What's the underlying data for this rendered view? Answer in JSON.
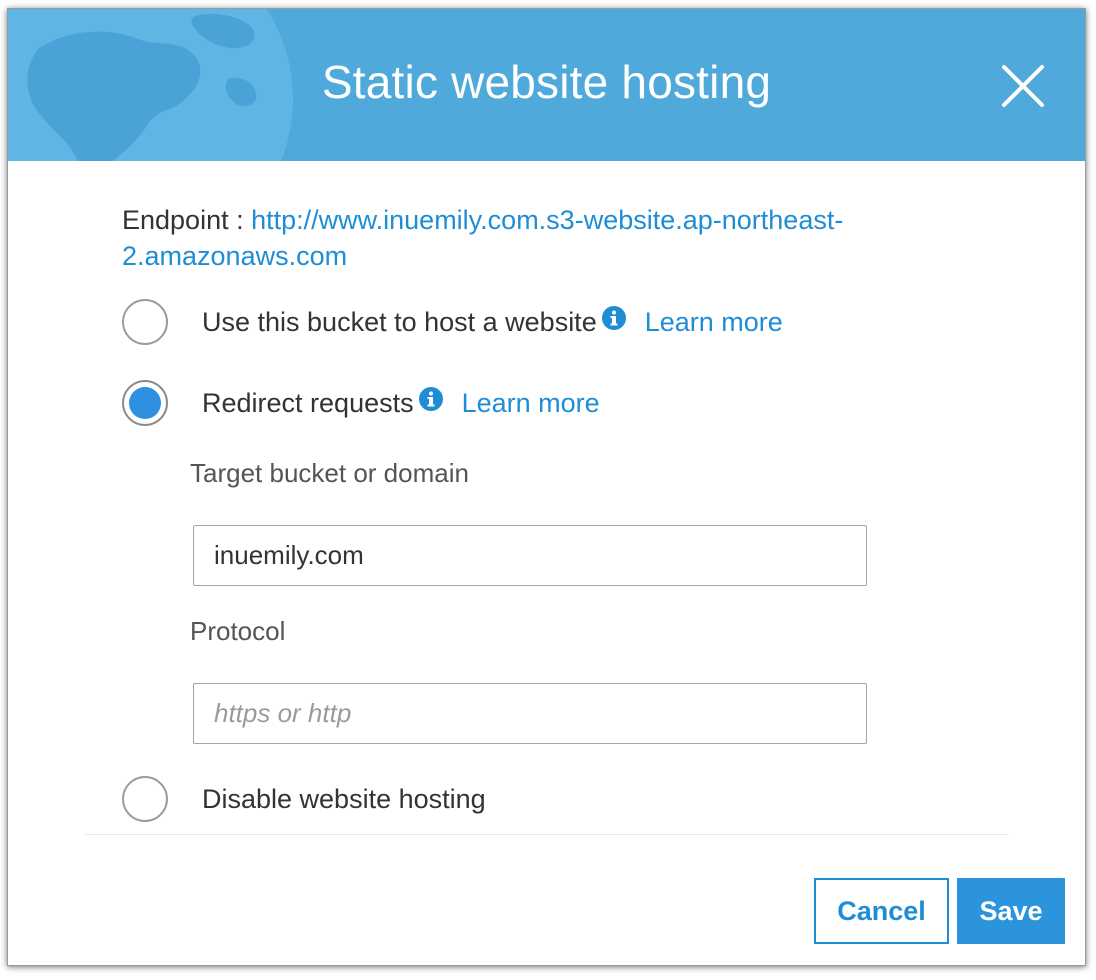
{
  "dialog": {
    "title": "Static website hosting",
    "close_icon": "close-icon",
    "header_color": "#4faadb"
  },
  "endpoint": {
    "label": "Endpoint : ",
    "url": "http://www.inuemily.com.s3-website.ap-northeast-2.amazonaws.com"
  },
  "options": [
    {
      "label": "Use this bucket to host a website",
      "learn_more": "Learn more",
      "selected": false,
      "icon": "info-icon"
    },
    {
      "label": "Redirect requests",
      "learn_more": "Learn more",
      "selected": true,
      "icon": "info-icon"
    },
    {
      "label": "Disable website hosting",
      "selected": false
    }
  ],
  "redirect": {
    "target_label": "Target bucket or domain",
    "target_value": "inuemily.com",
    "protocol_label": "Protocol",
    "protocol_value": "",
    "protocol_placeholder": "https or http"
  },
  "footer": {
    "cancel_label": "Cancel",
    "save_label": "Save"
  },
  "colors": {
    "accent": "#1f8dd6",
    "primary_button": "#2b94dd",
    "radio_selected": "#2f8fe0"
  }
}
